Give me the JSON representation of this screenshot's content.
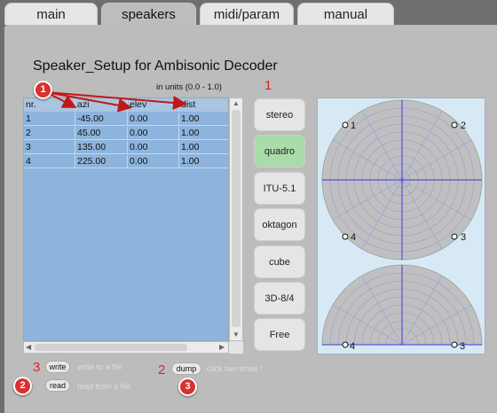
{
  "tabs": [
    {
      "label": "main"
    },
    {
      "label": "speakers"
    },
    {
      "label": "midi/param"
    },
    {
      "label": "manual"
    }
  ],
  "title": "Speaker_Setup for Ambisonic Decoder",
  "units_note": "in units (0.0 - 1.0)",
  "annotations": {
    "one": "1",
    "two": "2",
    "three": "3"
  },
  "table": {
    "headers": [
      "nr.",
      "azi",
      "elev",
      "dist"
    ],
    "rows": [
      [
        "1",
        "-45.00",
        "0.00",
        "1.00"
      ],
      [
        "2",
        "45.00",
        "0.00",
        "1.00"
      ],
      [
        "3",
        "135.00",
        "0.00",
        "1.00"
      ],
      [
        "4",
        "225.00",
        "0.00",
        "1.00"
      ]
    ]
  },
  "presets": [
    {
      "label": "stereo",
      "selected": false
    },
    {
      "label": "quadro",
      "selected": true
    },
    {
      "label": "ITU-5.1",
      "selected": false
    },
    {
      "label": "oktagon",
      "selected": false
    },
    {
      "label": "cube",
      "selected": false
    },
    {
      "label": "3D-8/4",
      "selected": false
    },
    {
      "label": "Free",
      "selected": false
    }
  ],
  "speaker_labels": [
    "1",
    "2",
    "3",
    "4"
  ],
  "controls": {
    "write_label": "write",
    "write_hint": "write to a file",
    "read_label": "read",
    "read_hint": "read from a file",
    "dump_label": "dump",
    "dump_hint": "click two times !"
  },
  "colors": {
    "table_bg": "#8db4dc",
    "selected_preset": "#a9dca8",
    "badge": "#d8312f",
    "arrow": "#c01818"
  }
}
